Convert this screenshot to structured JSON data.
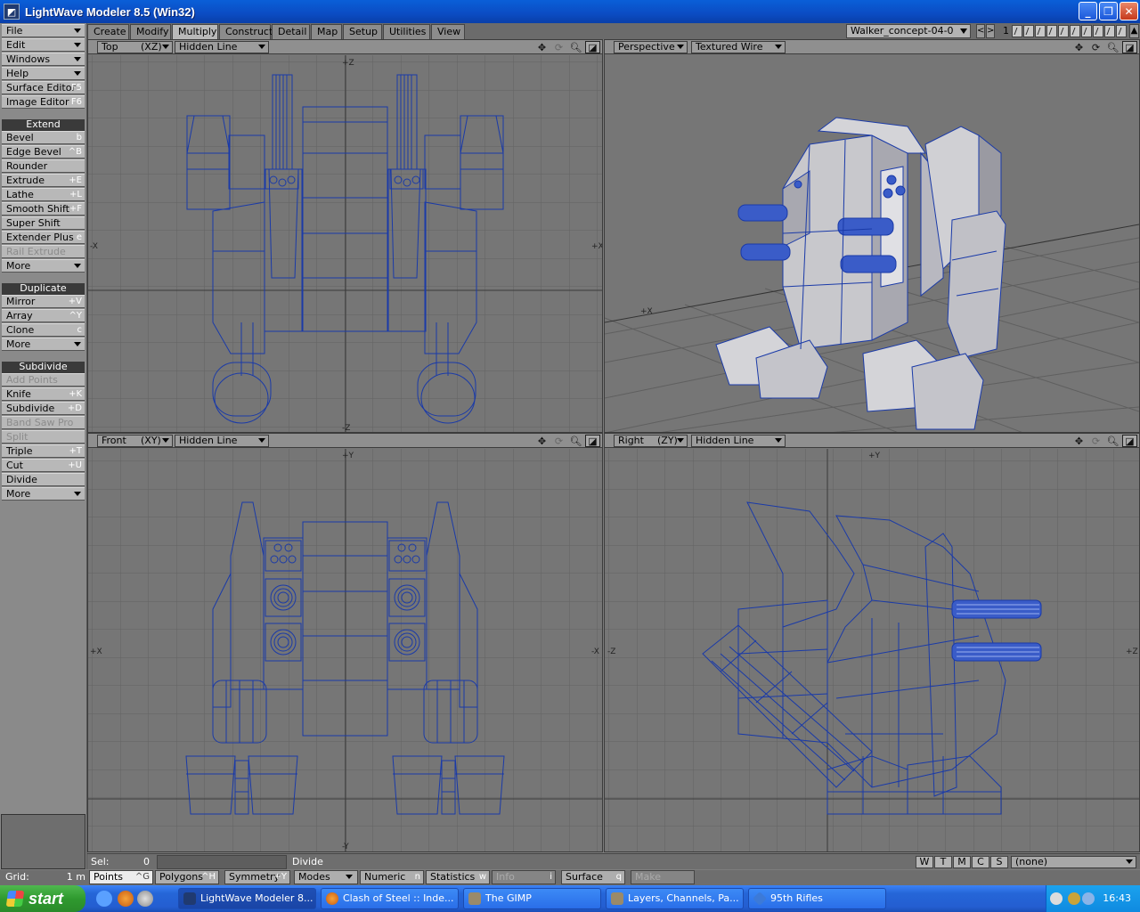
{
  "window": {
    "title": "LightWave Modeler 8.5 (Win32)",
    "app_icon": "lightwave-icon"
  },
  "tabs": [
    {
      "label": "Create",
      "active": false
    },
    {
      "label": "Modify",
      "active": false
    },
    {
      "label": "Multiply",
      "active": true
    },
    {
      "label": "Construct",
      "active": false
    },
    {
      "label": "Detail",
      "active": false
    },
    {
      "label": "Map",
      "active": false
    },
    {
      "label": "Setup",
      "active": false
    },
    {
      "label": "Utilities",
      "active": false
    },
    {
      "label": "View",
      "active": false
    }
  ],
  "object": {
    "name": "Walker_concept-04-0 ...*",
    "layer": "1"
  },
  "menus": {
    "file": "File",
    "edit": "Edit",
    "windows": "Windows",
    "help": "Help",
    "surface_editor": "Surface Editor",
    "surface_editor_sc": "F5",
    "image_editor": "Image Editor",
    "image_editor_sc": "F6"
  },
  "extend": {
    "header": "Extend",
    "items": [
      {
        "label": "Bevel",
        "sc": "b",
        "disabled": false
      },
      {
        "label": "Edge Bevel",
        "sc": "^B",
        "disabled": false
      },
      {
        "label": "Rounder",
        "sc": "",
        "disabled": false
      },
      {
        "label": "Extrude",
        "sc": "+E",
        "disabled": false
      },
      {
        "label": "Lathe",
        "sc": "+L",
        "disabled": false
      },
      {
        "label": "Smooth Shift",
        "sc": "+F",
        "disabled": false
      },
      {
        "label": "Super Shift",
        "sc": "",
        "disabled": false
      },
      {
        "label": "Extender Plus",
        "sc": "e",
        "disabled": false
      },
      {
        "label": "Rail Extrude",
        "sc": "",
        "disabled": true
      }
    ],
    "more": "More"
  },
  "duplicate": {
    "header": "Duplicate",
    "items": [
      {
        "label": "Mirror",
        "sc": "+V"
      },
      {
        "label": "Array",
        "sc": "^Y"
      },
      {
        "label": "Clone",
        "sc": "c"
      }
    ],
    "more": "More"
  },
  "subdivide": {
    "header": "Subdivide",
    "items": [
      {
        "label": "Add Points",
        "sc": "",
        "disabled": true
      },
      {
        "label": "Knife",
        "sc": "+K",
        "disabled": false
      },
      {
        "label": "Subdivide",
        "sc": "+D",
        "disabled": false
      },
      {
        "label": "Band Saw Pro",
        "sc": "",
        "disabled": true
      },
      {
        "label": "Split",
        "sc": "",
        "disabled": true
      },
      {
        "label": "Triple",
        "sc": "+T",
        "disabled": false
      },
      {
        "label": "Cut",
        "sc": "+U",
        "disabled": false
      },
      {
        "label": "Divide",
        "sc": "",
        "disabled": false
      }
    ],
    "more": "More"
  },
  "viewports": {
    "top": {
      "view": "Top",
      "axes": "(XZ)",
      "mode": "Hidden Line"
    },
    "persp": {
      "view": "Perspective",
      "mode": "Textured Wire"
    },
    "front": {
      "view": "Front",
      "axes": "(XY)",
      "mode": "Hidden Line"
    },
    "right": {
      "view": "Right",
      "axes": "(ZY)",
      "mode": "Hidden Line"
    }
  },
  "status": {
    "sel_label": "Sel:",
    "sel_value": "0",
    "message": "Divide",
    "wtmcs": [
      "W",
      "T",
      "M",
      "C",
      "S"
    ],
    "surface": "(none)"
  },
  "bottom": {
    "grid_label": "Grid:",
    "grid_value": "1 m",
    "points": "Points",
    "points_sc": "^G",
    "polygons": "Polygons",
    "polygons_sc": "^H",
    "symmetry": "Symmetry",
    "symmetry_sc": "+Y",
    "modes": "Modes",
    "numeric": "Numeric",
    "numeric_sc": "n",
    "statistics": "Statistics",
    "statistics_sc": "w",
    "info": "Info",
    "info_sc": "i",
    "surface": "Surface",
    "surface_sc": "q",
    "make": "Make"
  },
  "taskbar": {
    "start": "start",
    "tasks": [
      {
        "label": "LightWave Modeler 8...",
        "active": true
      },
      {
        "label": "Clash of Steel :: Inde...",
        "active": false
      },
      {
        "label": "The GIMP",
        "active": false
      },
      {
        "label": "Layers, Channels, Pa...",
        "active": false
      },
      {
        "label": "95th Rifles",
        "active": false
      }
    ],
    "clock": "16:43"
  },
  "colors": {
    "wire": "#1a3aa8",
    "viewport_bg": "#767676",
    "grid": "#5e5e5e"
  }
}
